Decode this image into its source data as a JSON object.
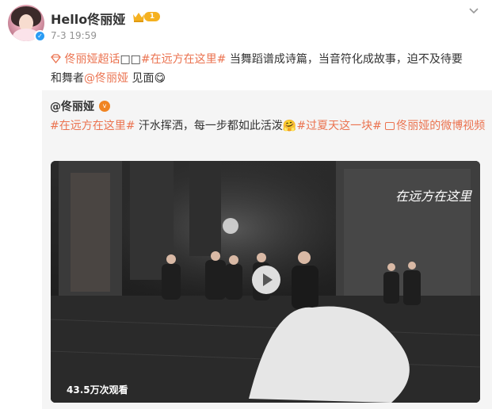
{
  "post": {
    "username": "Hello佟丽娅",
    "level": "1",
    "timestamp": "7-3 19:59",
    "text": {
      "supertopic": "佟丽娅超话",
      "boxes": "□□",
      "hashtag": "#在远方在这里#",
      "line1_rest": " 当舞蹈谱成诗篇，当音符化成故事，迫不及待要",
      "line2_start": "和舞者",
      "mention": "@佟丽娅",
      "line2_end": " 见面",
      "emoji": "😋"
    }
  },
  "repost": {
    "username": "@佟丽娅",
    "hashtag1": "#在远方在这里#",
    "text1": " 汗水挥洒，每一步都如此活泼",
    "emoji": "🤗",
    "hashtag2": "#过夏天这一块#",
    "video_link": "佟丽娅的微博视频",
    "video": {
      "view_count": "43.5万次观看"
    }
  },
  "colors": {
    "accent": "#eb7350",
    "verified": "#2a9cf4",
    "repost_bg": "#f5f5f5"
  },
  "icons": [
    "verified-icon",
    "crown-icon",
    "chevron-down-icon",
    "diamond-icon",
    "play-icon",
    "video-link-icon",
    "orange-v-badge"
  ]
}
